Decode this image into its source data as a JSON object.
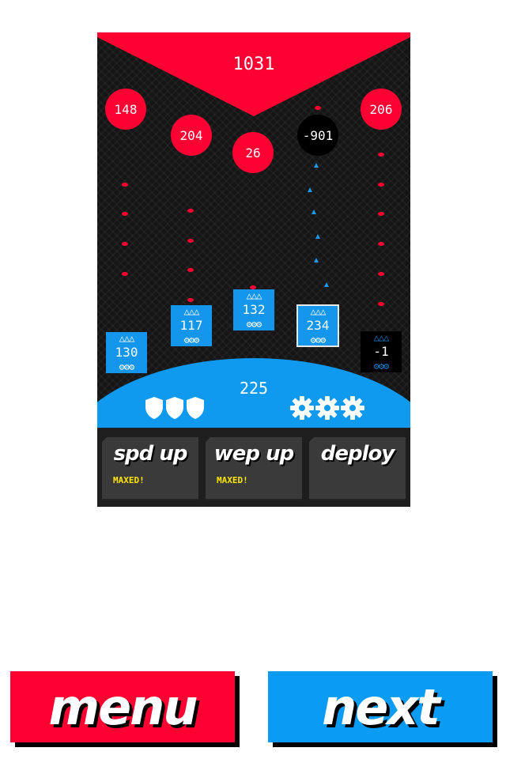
{
  "enemy_base": {
    "hp": "1031",
    "color": "#ff0033"
  },
  "enemies": [
    {
      "value": "148",
      "color": "#ff0033"
    },
    {
      "value": "204",
      "color": "#ff0033"
    },
    {
      "value": "26",
      "color": "#ff0033"
    },
    {
      "value": "-901",
      "color": "#000000"
    },
    {
      "value": "206",
      "color": "#ff0033"
    }
  ],
  "units": [
    {
      "value": "130",
      "triangles": "△△△",
      "gears": "⚙⚙⚙",
      "state": "normal"
    },
    {
      "value": "117",
      "triangles": "△△△",
      "gears": "⚙⚙⚙",
      "state": "normal"
    },
    {
      "value": "132",
      "triangles": "△△△",
      "gears": "⚙⚙⚙",
      "state": "normal"
    },
    {
      "value": "234",
      "triangles": "△△△",
      "gears": "⚙⚙⚙",
      "state": "selected"
    },
    {
      "value": "-1",
      "triangles": "△△△",
      "gears": "⚙⚙⚙",
      "state": "dead"
    }
  ],
  "player_base": {
    "hp": "225",
    "shield_icons": [
      "shield-icon",
      "shield-icon",
      "shield-icon"
    ],
    "gear_icons": [
      "gear-icon",
      "gear-icon",
      "gear-icon"
    ],
    "color": "#0f9af0"
  },
  "panels": {
    "spd_up": {
      "label": "spd up",
      "status": "MAXED!"
    },
    "wep_up": {
      "label": "wep up",
      "status": "MAXED!"
    },
    "deploy": {
      "label": "deploy"
    }
  },
  "buttons": {
    "menu": {
      "label": "menu",
      "color": "#ff0033"
    },
    "next": {
      "label": "next",
      "color": "#0a9cf5"
    }
  }
}
